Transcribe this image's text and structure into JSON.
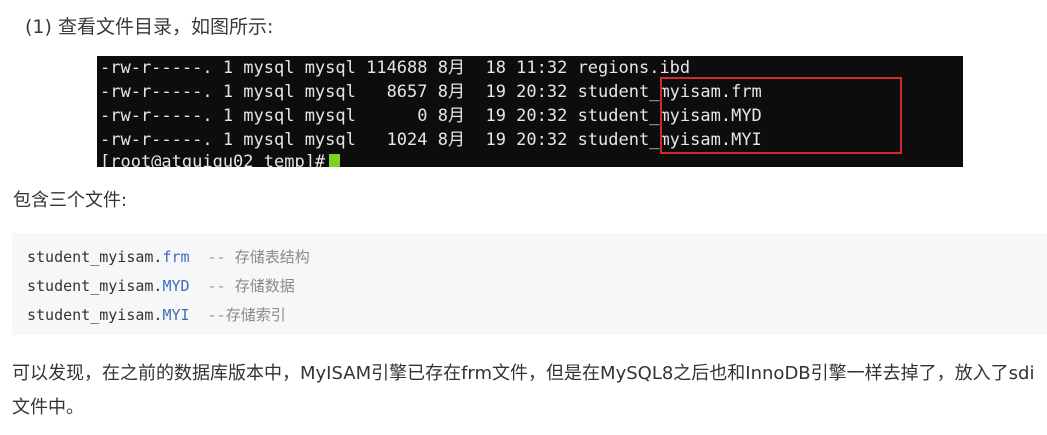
{
  "step_heading": "(1) 查看文件目录，如图所示:",
  "terminal": {
    "lines": [
      "-rw-r-----. 1 mysql mysql 114688 8月  18 11:32 regions.ibd",
      "-rw-r-----. 1 mysql mysql   8657 8月  19 20:32 student_myisam.frm",
      "-rw-r-----. 1 mysql mysql      0 8月  19 20:32 student_myisam.MYD",
      "-rw-r-----. 1 mysql mysql   1024 8月  19 20:32 student_myisam.MYI"
    ],
    "prompt": "[root@atguigu02 temp]#",
    "highlight_color": "#d62828",
    "cursor_color": "#7ed321"
  },
  "intro": "包含三个文件:",
  "code_block": {
    "rows": [
      {
        "base": "student_myisam.",
        "ext": "frm",
        "sep": "  -- ",
        "comment": "存储表结构"
      },
      {
        "base": "student_myisam.",
        "ext": "MYD",
        "sep": "  -- ",
        "comment": "存储数据"
      },
      {
        "base": "student_myisam.",
        "ext": "MYI",
        "sep": "  --",
        "comment": "存储索引"
      }
    ]
  },
  "paragraph": "可以发现，在之前的数据库版本中，MyISAM引擎已存在frm文件，但是在MySQL8之后也和InnoDB引擎一样去掉了，放入了sdi文件中。"
}
